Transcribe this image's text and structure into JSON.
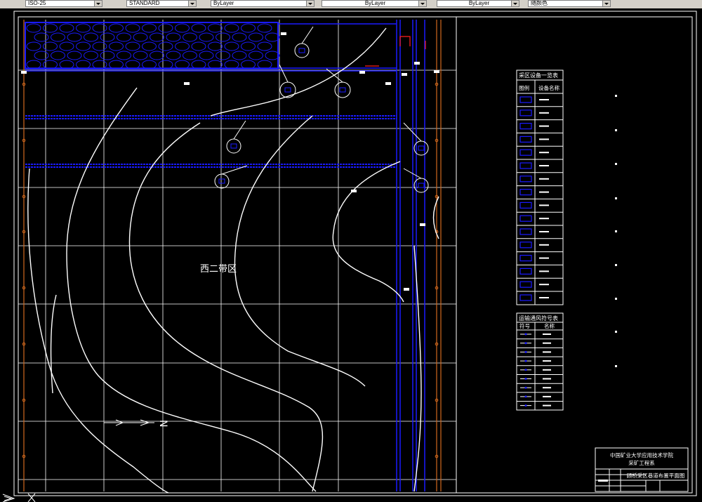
{
  "toolbar": {
    "combo1": "ISO-25",
    "combo2": "STANDARD",
    "layer1": "ByLayer",
    "layer2": "ByLayer",
    "layer3": "ByLayer",
    "color": "随颜色"
  },
  "colors": {
    "background": "#000000",
    "white": "#ffffff",
    "blue": "#1a1aff",
    "orange": "#d2691e",
    "red": "#ff2020"
  },
  "drawing": {
    "zone_label": "西二带区",
    "north_label": "N"
  },
  "equipment_table": {
    "title": "采区设备一览表",
    "headers": [
      "图例",
      "设备名称"
    ],
    "rows": [
      "",
      "",
      "",
      "",
      "",
      "",
      "",
      "",
      "",
      "",
      "",
      "",
      "",
      "",
      "",
      ""
    ]
  },
  "transport_table": {
    "title": "运输通风符号表",
    "headers": [
      "符号",
      "名称"
    ],
    "rows": [
      "",
      "",
      "",
      "",
      "",
      "",
      "",
      "",
      ""
    ]
  },
  "title_block": {
    "line1": "中国矿业大学应用技术学院",
    "line2": "采矿工程系",
    "drawing_title": "顾桥采区巷道布置平面图"
  }
}
